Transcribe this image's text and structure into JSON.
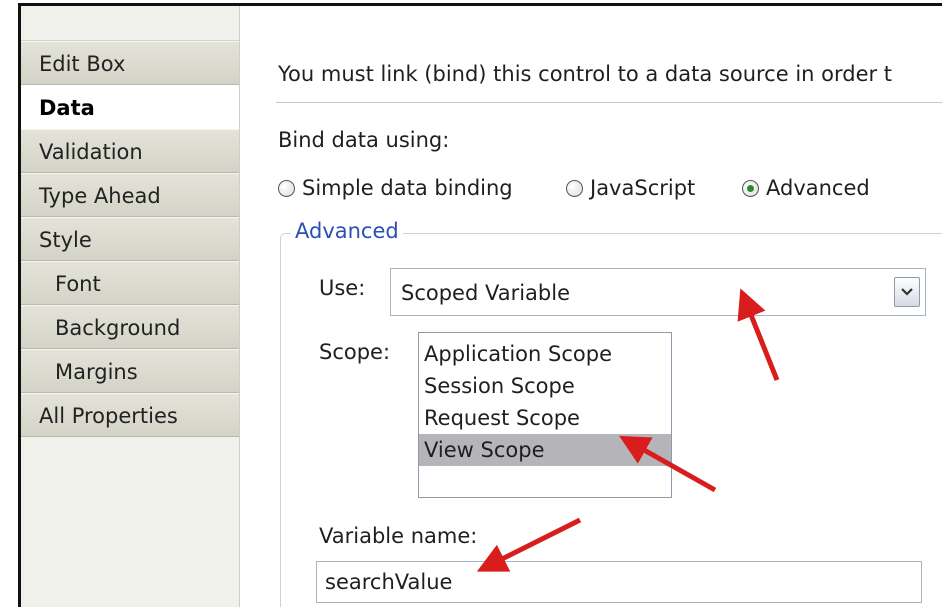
{
  "sidebar": {
    "items": [
      {
        "label": "Edit Box",
        "selected": false,
        "sub": false
      },
      {
        "label": "Data",
        "selected": true,
        "sub": false
      },
      {
        "label": "Validation",
        "selected": false,
        "sub": false
      },
      {
        "label": "Type Ahead",
        "selected": false,
        "sub": false
      },
      {
        "label": "Style",
        "selected": false,
        "sub": false
      },
      {
        "label": "Font",
        "selected": false,
        "sub": true
      },
      {
        "label": "Background",
        "selected": false,
        "sub": true
      },
      {
        "label": "Margins",
        "selected": false,
        "sub": true
      },
      {
        "label": "All Properties",
        "selected": false,
        "sub": false
      }
    ]
  },
  "main": {
    "intro_text": "You must link (bind) this control to a data source in order t",
    "bind_label": "Bind data using:",
    "radios": [
      {
        "label": "Simple data binding",
        "checked": false
      },
      {
        "label": "JavaScript",
        "checked": false
      },
      {
        "label": "Advanced",
        "checked": true
      }
    ],
    "advanced_legend": "Advanced",
    "use_label": "Use:",
    "use_value": "Scoped Variable",
    "scope_label": "Scope:",
    "scope_options": [
      "Application Scope",
      "Session Scope",
      "Request Scope",
      "View Scope"
    ],
    "scope_selected": "View Scope",
    "variable_name_label": "Variable name:",
    "variable_name_value": "searchValue"
  },
  "colors": {
    "annotation_arrow": "#d91c1c",
    "legend_text": "#2a4fb5",
    "radio_checked": "#2e8b2e",
    "list_selection": "#b5b5b9"
  },
  "icons": {
    "dropdown": "chevron-down-icon",
    "radio": "radio-button-icon",
    "annotation": "red-arrow-icon"
  }
}
